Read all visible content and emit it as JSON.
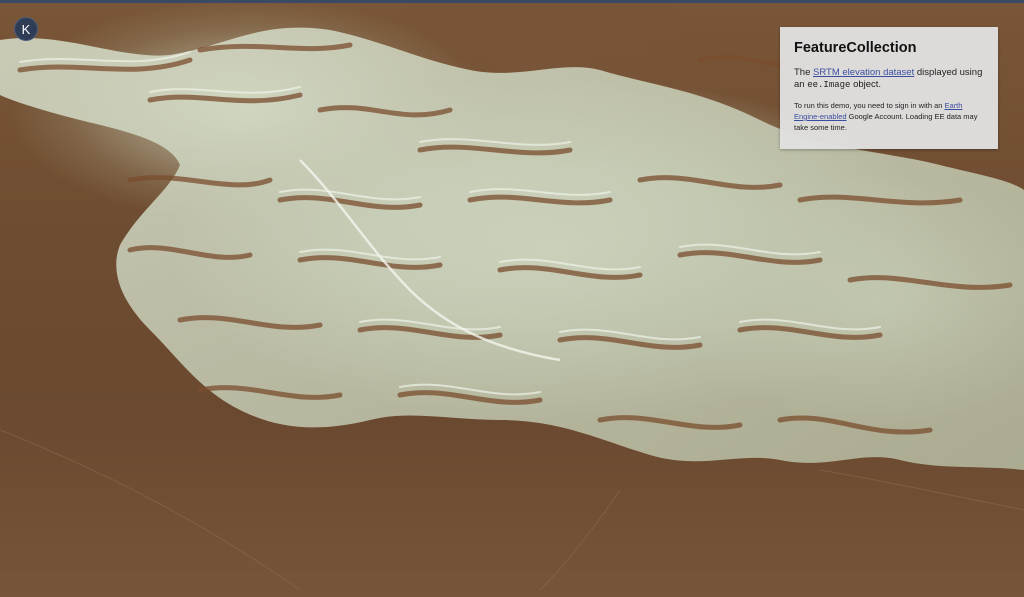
{
  "header": {
    "accent_color": "#3b4a63"
  },
  "user": {
    "avatar_initial": "K",
    "avatar_color": "#2e3d55"
  },
  "map": {
    "description": "3D shaded relief terrain rendering",
    "colors": {
      "lowland": "#6e4c31",
      "ridge": "#8a5a36",
      "highland": "#dde6d3"
    }
  },
  "panel": {
    "title": "FeatureCollection",
    "desc_prefix": "The ",
    "desc_link": "SRTM elevation dataset",
    "desc_mid": " displayed using an ",
    "desc_code": "ee.Image",
    "desc_suffix": " object.",
    "note_prefix": "To run this demo, you need to sign in with an ",
    "note_link": "Earth Engine-enabled",
    "note_suffix": " Google Account. Loading EE data may take some time."
  }
}
